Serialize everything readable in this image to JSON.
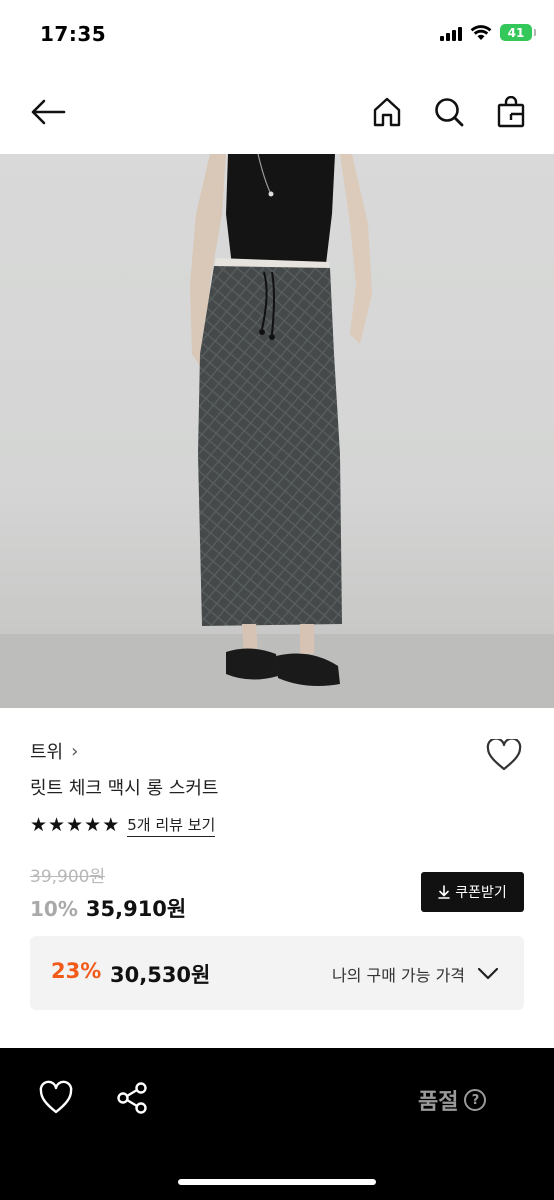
{
  "status_bar": {
    "time": "17:35",
    "battery": "41"
  },
  "nav": {
    "back_icon": "arrow-left-icon",
    "home_icon": "home-icon",
    "search_icon": "search-icon",
    "bag_icon": "shopping-bag-icon"
  },
  "product": {
    "brand": "트위",
    "brand_chevron": "›",
    "name": "릿트 체크 맥시 롱 스커트",
    "rating_stars": 5,
    "review_link": "5개 리뷰 보기",
    "original_price": "39,900원",
    "discount_rate": "10%",
    "sale_price": "35,910원",
    "coupon_label": "쿠폰받기"
  },
  "my_price": {
    "discount_rate": "23%",
    "price": "30,530원",
    "label": "나의 구매 가능 가격"
  },
  "bottom_bar": {
    "status": "품절",
    "help": "?"
  },
  "colors": {
    "accent_orange": "#f25a19",
    "bottom_bar_bg": "#000000",
    "battery_green": "#34c759"
  }
}
